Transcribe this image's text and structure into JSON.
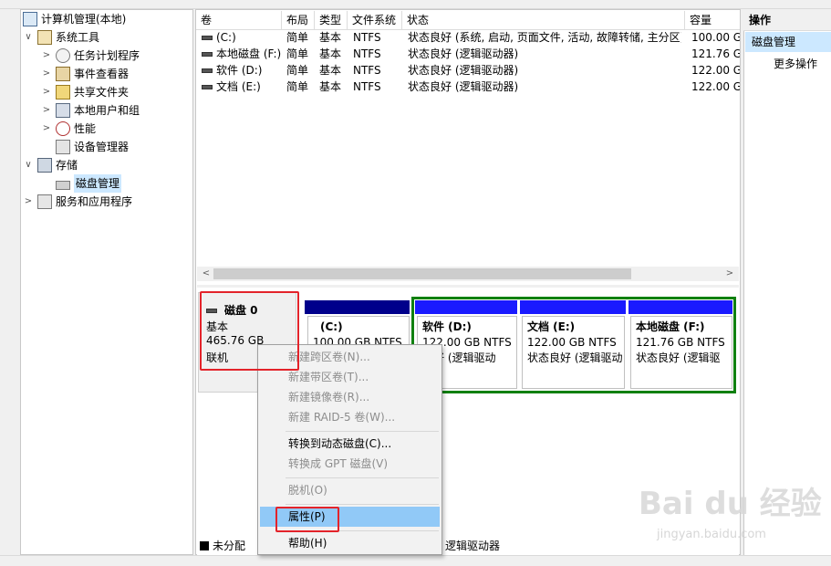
{
  "tree": {
    "items": [
      {
        "label": "计算机管理(本地)",
        "arrow": "",
        "icon": "computer-management-icon"
      },
      {
        "label": "系统工具",
        "arrow": "∨",
        "icon": "system-tools-icon"
      },
      {
        "label": "任务计划程序",
        "arrow": ">",
        "icon": "task-scheduler-icon"
      },
      {
        "label": "事件查看器",
        "arrow": ">",
        "icon": "event-viewer-icon"
      },
      {
        "label": "共享文件夹",
        "arrow": ">",
        "icon": "shared-folders-icon"
      },
      {
        "label": "本地用户和组",
        "arrow": ">",
        "icon": "local-users-icon"
      },
      {
        "label": "性能",
        "arrow": ">",
        "icon": "performance-icon"
      },
      {
        "label": "设备管理器",
        "arrow": "",
        "icon": "device-manager-icon"
      },
      {
        "label": "存储",
        "arrow": "∨",
        "icon": "storage-icon"
      },
      {
        "label": "磁盘管理",
        "arrow": "",
        "icon": "disk-management-icon"
      },
      {
        "label": "服务和应用程序",
        "arrow": ">",
        "icon": "services-apps-icon"
      }
    ]
  },
  "volumes": {
    "headers": [
      "卷",
      "布局",
      "类型",
      "文件系统",
      "状态",
      "容量"
    ],
    "rows": [
      [
        "(C:)",
        "简单",
        "基本",
        "NTFS",
        "状态良好 (系统, 启动, 页面文件, 活动, 故障转储, 主分区)",
        "100.00 G"
      ],
      [
        "本地磁盘 (F:)",
        "简单",
        "基本",
        "NTFS",
        "状态良好 (逻辑驱动器)",
        "121.76 G"
      ],
      [
        "软件 (D:)",
        "简单",
        "基本",
        "NTFS",
        "状态良好 (逻辑驱动器)",
        "122.00 G"
      ],
      [
        "文档 (E:)",
        "简单",
        "基本",
        "NTFS",
        "状态良好 (逻辑驱动器)",
        "122.00 G"
      ]
    ]
  },
  "disk": {
    "name": "磁盘 0",
    "type": "基本",
    "size": "465.76 GB",
    "status": "联机",
    "partitions": [
      {
        "name": "(C:)",
        "size": "100.00 GB NTFS",
        "status": ""
      },
      {
        "name": "软件  (D:)",
        "size": "122.00 GB NTFS",
        "status": "良好 (逻辑驱动"
      },
      {
        "name": "文档  (E:)",
        "size": "122.00 GB NTFS",
        "status": "状态良好 (逻辑驱动"
      },
      {
        "name": "本地磁盘  (F:)",
        "size": "121.76 GB NTFS",
        "status": "状态良好 (逻辑驱"
      }
    ]
  },
  "legend": {
    "unallocated": "未分配",
    "logical": "逻辑驱动器"
  },
  "actions": {
    "header": "操作",
    "selected": "磁盘管理",
    "more": "更多操作"
  },
  "context_menu": {
    "items": [
      {
        "label": "新建跨区卷(N)...",
        "disabled": true
      },
      {
        "label": "新建带区卷(T)...",
        "disabled": true
      },
      {
        "label": "新建镜像卷(R)...",
        "disabled": true
      },
      {
        "label": "新建 RAID-5 卷(W)...",
        "disabled": true
      },
      {
        "label": "转换到动态磁盘(C)...",
        "disabled": false
      },
      {
        "label": "转换成 GPT 磁盘(V)",
        "disabled": true
      },
      {
        "label": "脱机(O)",
        "disabled": true
      },
      {
        "label": "属性(P)",
        "disabled": false,
        "highlighted": true
      },
      {
        "label": "帮助(H)",
        "disabled": false
      }
    ]
  },
  "watermark": {
    "logo": "Bai du 经验",
    "url": "jingyan.baidu.com"
  },
  "colors": {
    "primary_partition_bar": "#00008b",
    "logical_partition_bar": "#1a1aff",
    "extended_border": "#108010",
    "highlight_box": "#e3232a",
    "menu_hover": "#91c9f7"
  }
}
